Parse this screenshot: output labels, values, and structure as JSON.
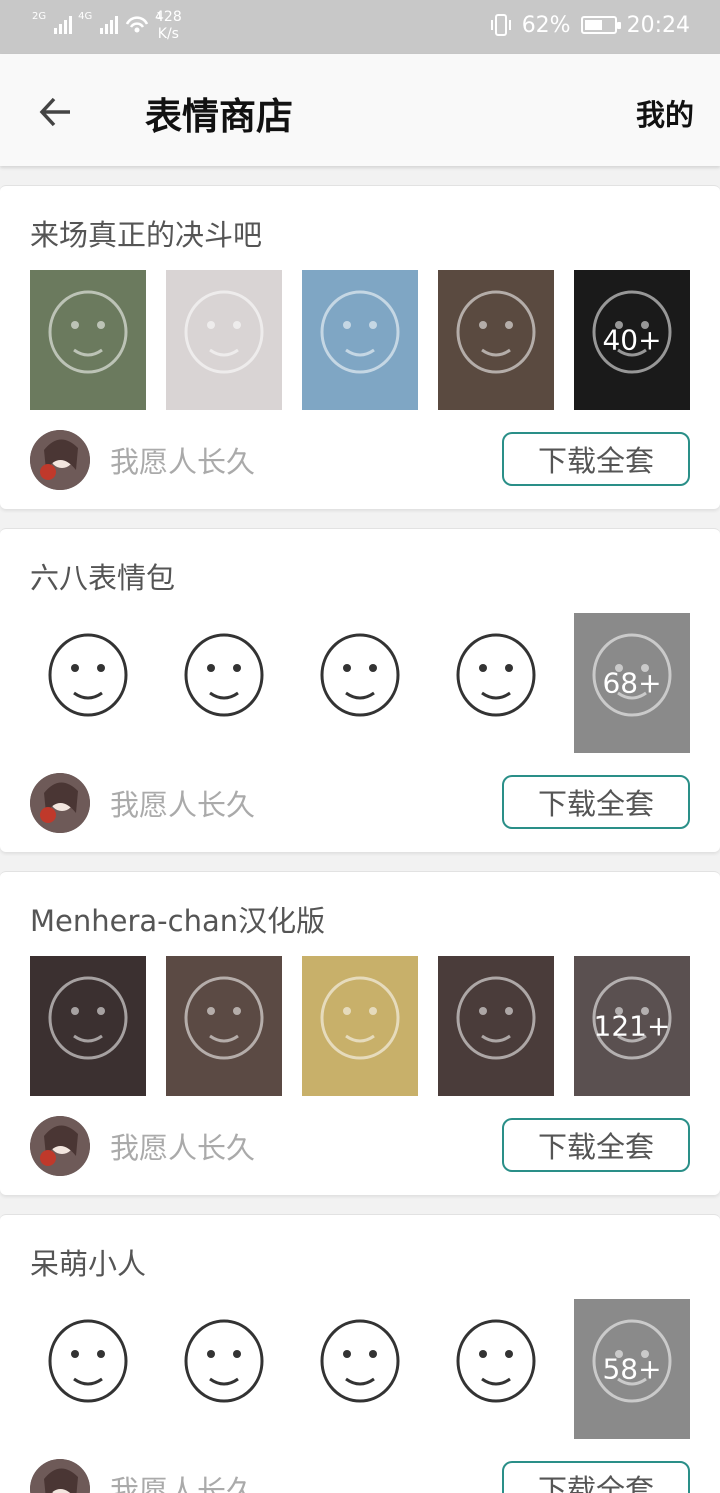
{
  "status_bar": {
    "network_1": "2G",
    "network_2": "4G",
    "wifi_badge": "1",
    "speed_value": "428",
    "speed_unit": "K/s",
    "battery_percent": "62%",
    "battery_level": 0.62,
    "time": "20:24"
  },
  "header": {
    "title": "表情商店",
    "mine_label": "我的"
  },
  "packs": [
    {
      "title": "来场真正的决斗吧",
      "thumb_colors": [
        "#6b7a5e",
        "#d9d4d4",
        "#7fa6c4",
        "#5a4a40",
        "#1a1a1a"
      ],
      "count_label": "40+",
      "author": "我愿人长久",
      "download_label": "下载全套"
    },
    {
      "title": "六八表情包",
      "thumb_colors": [
        "#ffffff",
        "#ffffff",
        "#ffffff",
        "#ffffff",
        "#8a8a8a"
      ],
      "count_label": "68+",
      "author": "我愿人长久",
      "download_label": "下载全套"
    },
    {
      "title": "Menhera-chan汉化版",
      "thumb_colors": [
        "#3b3030",
        "#5b4a44",
        "#c8b06a",
        "#4a3c3a",
        "#5a5050"
      ],
      "count_label": "121+",
      "author": "我愿人长久",
      "download_label": "下载全套"
    },
    {
      "title": "呆萌小人",
      "thumb_colors": [
        "#ffffff",
        "#ffffff",
        "#ffffff",
        "#ffffff",
        "#8a8a8a"
      ],
      "count_label": "58+",
      "author": "我愿人长久",
      "download_label": "下载全套"
    }
  ]
}
